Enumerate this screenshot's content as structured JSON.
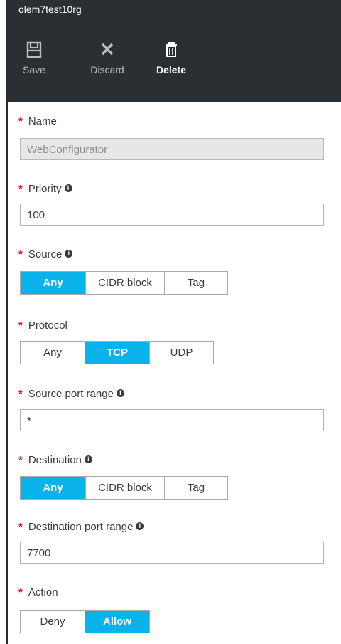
{
  "blade": {
    "title": "olem7test10rg"
  },
  "commands": [
    {
      "label": "Save",
      "icon": "save-icon"
    },
    {
      "label": "Discard",
      "icon": "close-icon"
    },
    {
      "label": "Delete",
      "icon": "trash-icon"
    }
  ],
  "required_marker": "*",
  "info_glyph": "i",
  "fields": {
    "name": {
      "label": "Name",
      "value": "WebConfigurator"
    },
    "priority": {
      "label": "Priority",
      "value": "100"
    },
    "source": {
      "label": "Source",
      "options": [
        "Any",
        "CIDR block",
        "Tag"
      ],
      "selected": "Any"
    },
    "protocol": {
      "label": "Protocol",
      "options": [
        "Any",
        "TCP",
        "UDP"
      ],
      "selected": "TCP"
    },
    "source_port_range": {
      "label": "Source port range",
      "value": "*"
    },
    "destination": {
      "label": "Destination",
      "options": [
        "Any",
        "CIDR block",
        "Tag"
      ],
      "selected": "Any"
    },
    "destination_port_range": {
      "label": "Destination port range",
      "value": "7700"
    },
    "action": {
      "label": "Action",
      "options": [
        "Deny",
        "Allow"
      ],
      "selected": "Allow"
    }
  },
  "colors": {
    "header_bg": "#2b2f33",
    "selected_bg": "#0ab2ec",
    "required": "#e81123"
  }
}
